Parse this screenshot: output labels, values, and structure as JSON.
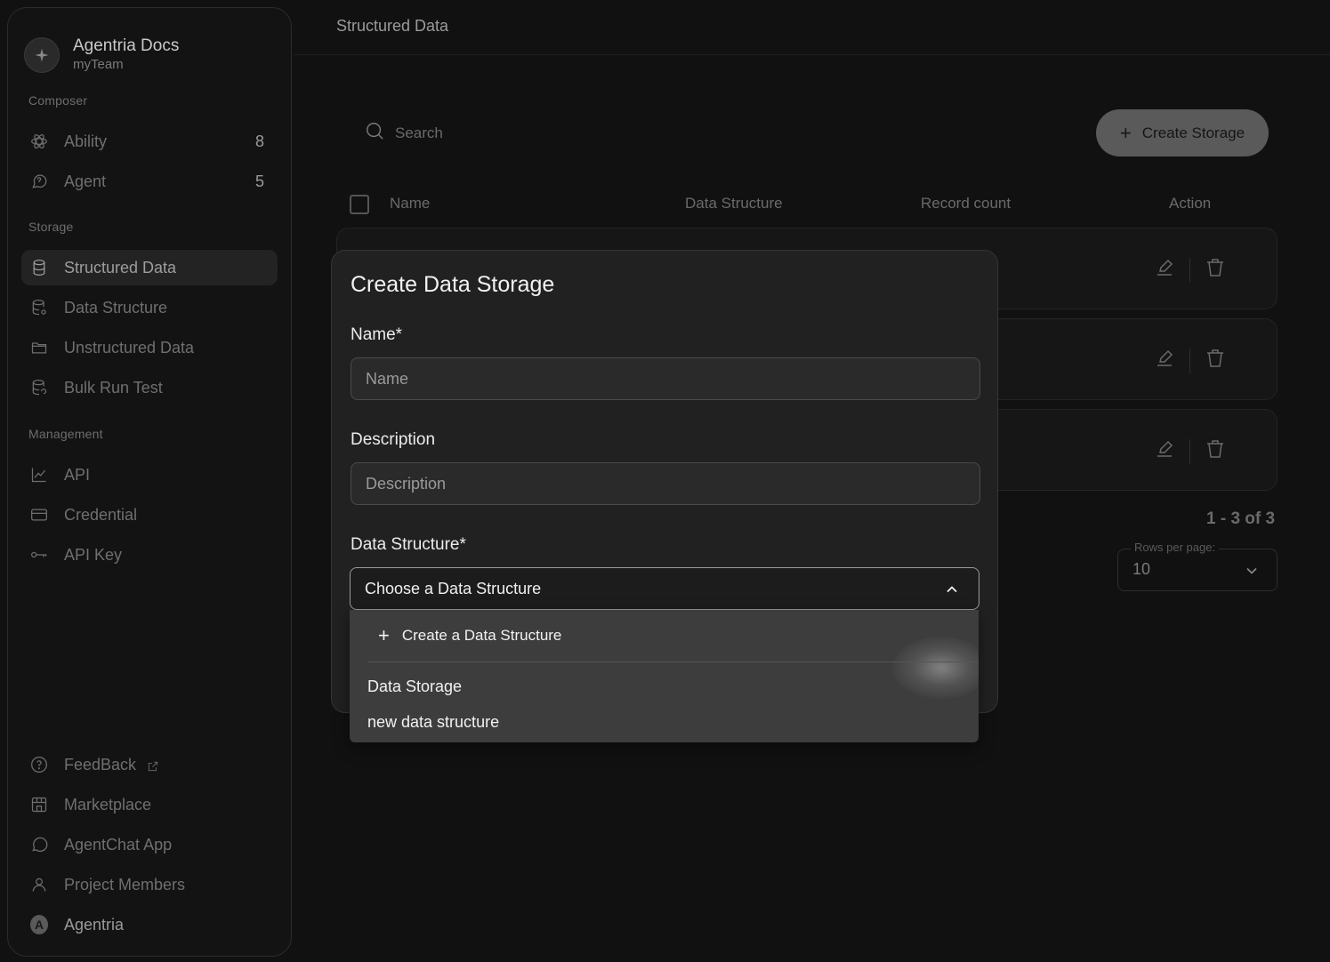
{
  "team": {
    "name": "Agentria Docs",
    "sub": "myTeam"
  },
  "sidebar": {
    "sections": {
      "composer": "Composer",
      "storage": "Storage",
      "management": "Management"
    },
    "composer_items": [
      {
        "label": "Ability",
        "count": "8",
        "icon": "ability-icon"
      },
      {
        "label": "Agent",
        "count": "5",
        "icon": "agent-icon"
      }
    ],
    "storage_items": [
      {
        "label": "Structured Data",
        "icon": "database-icon",
        "active": true
      },
      {
        "label": "Data Structure",
        "icon": "database-settings-icon"
      },
      {
        "label": "Unstructured Data",
        "icon": "folder-icon"
      },
      {
        "label": "Bulk Run Test",
        "icon": "database-refresh-icon"
      }
    ],
    "management_items": [
      {
        "label": "API",
        "icon": "chart-line-icon"
      },
      {
        "label": "Credential",
        "icon": "credit-card-icon"
      },
      {
        "label": "API Key",
        "icon": "key-icon"
      }
    ],
    "bottom_items": [
      {
        "label": "FeedBack",
        "icon": "help-circle-icon"
      },
      {
        "label": "Marketplace",
        "icon": "store-icon"
      },
      {
        "label": "AgentChat App",
        "icon": "chat-bubble-icon"
      },
      {
        "label": "Project Members",
        "icon": "user-icon"
      },
      {
        "label": "Agentria",
        "icon": "avatar-a"
      }
    ],
    "avatar_letter": "A"
  },
  "header": {
    "title": "Structured Data"
  },
  "toolbar": {
    "search_placeholder": "Search",
    "create_label": "Create Storage"
  },
  "table": {
    "columns": [
      "Name",
      "Data Structure",
      "Record count",
      "Action"
    ]
  },
  "pagination": {
    "info": "1 - 3 of 3",
    "rows_label": "Rows per page:",
    "rows_value": "10"
  },
  "modal": {
    "title": "Create Data Storage",
    "name_label": "Name*",
    "name_placeholder": "Name",
    "description_label": "Description",
    "description_placeholder": "Description",
    "structure_label": "Data Structure*",
    "structure_placeholder": "Choose a Data Structure",
    "dropdown": {
      "create_label": "Create a Data Structure",
      "options": [
        "Data Storage",
        "new data structure"
      ]
    }
  },
  "colors": {
    "background": "#111111",
    "accent_button": "#5a5a5a",
    "modal": "#212121",
    "dropdown": "#3d3d3d"
  }
}
